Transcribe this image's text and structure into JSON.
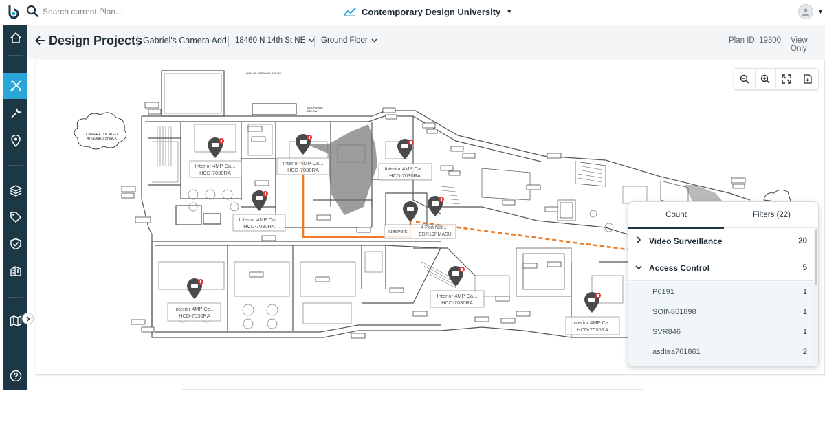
{
  "topbar": {
    "search_placeholder": "Search current Plan...",
    "org_name": "Contemporary Design University"
  },
  "nav": {
    "items": [
      "home-icon",
      "design-tools-icon",
      "wrench-icon",
      "location-pin-icon",
      "layers-icon",
      "tag-icon",
      "shield-check-icon",
      "building-icon",
      "map-icon",
      "help-icon"
    ],
    "active": "design-tools-icon"
  },
  "header": {
    "title": "Design Projects",
    "project_name": "Gabriel's Camera Add",
    "address": "18460 N 14th St NE",
    "floor": "Ground Floor",
    "plan_id": "Plan ID: 19300",
    "view_only": "View Only"
  },
  "floorplan": {
    "notes": {
      "camera_located": "CAMERA LOCATED",
      "at_guard_shack": "AT GUARD SHACK",
      "areaway": "LINE OF AREAWAY BELOW",
      "mech_shaft": "MECH SHAFT",
      "below": "BELOW"
    },
    "cameras": [
      {
        "label": "Interior 4MP Ca...",
        "model": "HCD-7030RA"
      },
      {
        "label": "Interior 4MP Ca...",
        "model": "HCD-7030RA"
      },
      {
        "label": "Interior 4MP Ca...",
        "model": "HCD-7030RA"
      },
      {
        "label": "Interior 4MP Ca...",
        "model": "HCD-7030RA"
      },
      {
        "label": "Interior 4MP Ca...",
        "model": "HCD-7030RA"
      },
      {
        "label": "Interior 4MP Ca...",
        "model": "HCD-7030RA"
      },
      {
        "label": "Interior 4MP Ca...",
        "model": "HCD-7030RA"
      }
    ],
    "network": {
      "label": "Network",
      "sub": "4 Port Net...",
      "model": "EDR19PMASU"
    }
  },
  "count_panel": {
    "tabs": [
      "Count",
      "Filters (22)"
    ],
    "categories": [
      {
        "label": "Video Surveillance",
        "count": "20",
        "expanded": false
      },
      {
        "label": "Access Control",
        "count": "5",
        "expanded": true
      }
    ],
    "access_items": [
      {
        "label": "P6191",
        "count": "1"
      },
      {
        "label": "SOIN861898",
        "count": "1"
      },
      {
        "label": "SVR846",
        "count": "1"
      },
      {
        "label": "asdtea761861",
        "count": "2"
      }
    ]
  },
  "colors": {
    "nav_bg": "#1c3846",
    "nav_active": "#2aa5d8",
    "cable": "#f07a22",
    "marker": "#4a4a4a",
    "badge": "#e03a3a"
  }
}
